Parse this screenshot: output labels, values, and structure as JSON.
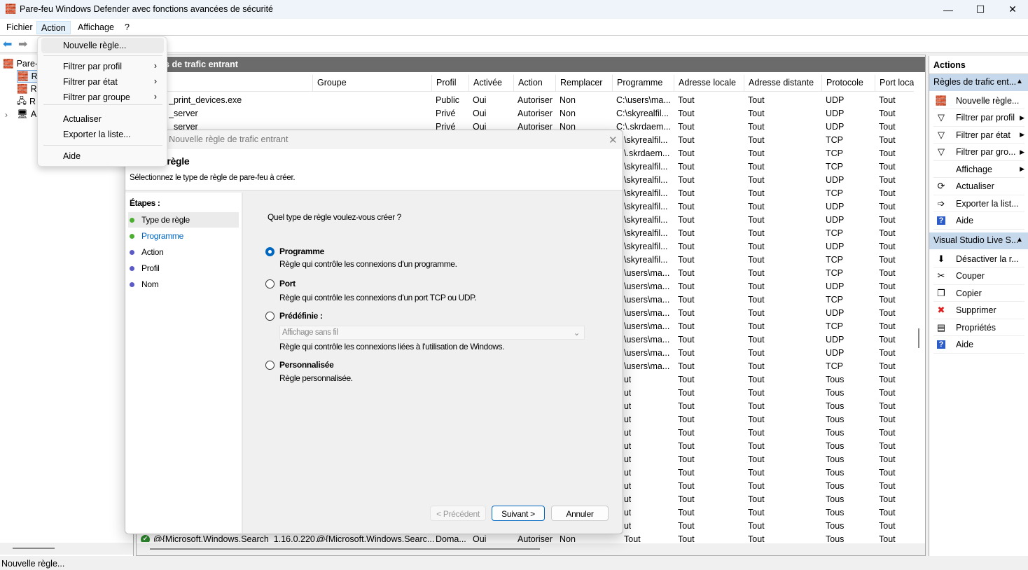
{
  "window": {
    "title": "Pare-feu Windows Defender avec fonctions avancées de sécurité",
    "icon": "firewall-icon"
  },
  "menubar": [
    "Fichier",
    "Action",
    "Affichage",
    "?"
  ],
  "tree": {
    "items": [
      {
        "label": "Pare-"
      },
      {
        "label": "R"
      },
      {
        "label": "R"
      },
      {
        "label": "R"
      },
      {
        "label": "A"
      }
    ]
  },
  "center": {
    "band": "Règles de trafic entrant",
    "columns": [
      "",
      "Groupe",
      "Profil",
      "Activée",
      "Action",
      "Remplacer",
      "Programme",
      "Adresse locale",
      "Adresse distante",
      "Protocole",
      "Port loca"
    ],
    "rows": [
      [
        "_print_devices.exe",
        "",
        "Public",
        "Oui",
        "Autoriser",
        "Non",
        "C:\\users\\ma...",
        "Tout",
        "Tout",
        "UDP",
        "Tout"
      ],
      [
        "_server",
        "",
        "Privé",
        "Oui",
        "Autoriser",
        "Non",
        "C:\\skyrealfil...",
        "Tout",
        "Tout",
        "UDP",
        "Tout"
      ],
      [
        "_server",
        "",
        "Privé",
        "Oui",
        "Autoriser",
        "Non",
        "C:\\.skrdaem...",
        "Tout",
        "Tout",
        "UDP",
        "Tout"
      ],
      [
        "",
        "",
        "",
        "",
        "",
        "",
        "\\skyrealfil...",
        "Tout",
        "Tout",
        "TCP",
        "Tout"
      ],
      [
        "",
        "",
        "",
        "",
        "",
        "",
        "\\.skrdaem...",
        "Tout",
        "Tout",
        "TCP",
        "Tout"
      ],
      [
        "",
        "",
        "",
        "",
        "",
        "",
        "\\skyrealfil...",
        "Tout",
        "Tout",
        "TCP",
        "Tout"
      ],
      [
        "",
        "",
        "",
        "",
        "",
        "",
        "\\skyrealfil...",
        "Tout",
        "Tout",
        "UDP",
        "Tout"
      ],
      [
        "",
        "",
        "",
        "",
        "",
        "",
        "\\skyrealfil...",
        "Tout",
        "Tout",
        "TCP",
        "Tout"
      ],
      [
        "",
        "",
        "",
        "",
        "",
        "",
        "\\skyrealfil...",
        "Tout",
        "Tout",
        "UDP",
        "Tout"
      ],
      [
        "",
        "",
        "",
        "",
        "",
        "",
        "\\skyrealfil...",
        "Tout",
        "Tout",
        "UDP",
        "Tout"
      ],
      [
        "",
        "",
        "",
        "",
        "",
        "",
        "\\skyrealfil...",
        "Tout",
        "Tout",
        "TCP",
        "Tout"
      ],
      [
        "",
        "",
        "",
        "",
        "",
        "",
        "\\skyrealfil...",
        "Tout",
        "Tout",
        "UDP",
        "Tout"
      ],
      [
        "",
        "",
        "",
        "",
        "",
        "",
        "\\skyrealfil...",
        "Tout",
        "Tout",
        "TCP",
        "Tout"
      ],
      [
        "",
        "",
        "",
        "",
        "",
        "",
        "\\users\\ma...",
        "Tout",
        "Tout",
        "TCP",
        "Tout"
      ],
      [
        "",
        "",
        "",
        "",
        "",
        "",
        "\\users\\ma...",
        "Tout",
        "Tout",
        "UDP",
        "Tout"
      ],
      [
        "",
        "",
        "",
        "",
        "",
        "",
        "\\users\\ma...",
        "Tout",
        "Tout",
        "TCP",
        "Tout"
      ],
      [
        "",
        "",
        "",
        "",
        "",
        "",
        "\\users\\ma...",
        "Tout",
        "Tout",
        "UDP",
        "Tout"
      ],
      [
        "",
        "",
        "",
        "",
        "",
        "",
        "\\users\\ma...",
        "Tout",
        "Tout",
        "TCP",
        "Tout"
      ],
      [
        "",
        "",
        "",
        "",
        "",
        "",
        "\\users\\ma...",
        "Tout",
        "Tout",
        "UDP",
        "Tout"
      ],
      [
        "",
        "",
        "",
        "",
        "",
        "",
        "\\users\\ma...",
        "Tout",
        "Tout",
        "UDP",
        "Tout"
      ],
      [
        "",
        "",
        "",
        "",
        "",
        "",
        "\\users\\ma...",
        "Tout",
        "Tout",
        "TCP",
        "Tout"
      ],
      [
        "",
        "",
        "",
        "",
        "",
        "",
        "ut",
        "Tout",
        "Tout",
        "Tous",
        "Tout"
      ],
      [
        "",
        "",
        "",
        "",
        "",
        "",
        "ut",
        "Tout",
        "Tout",
        "Tous",
        "Tout"
      ],
      [
        "",
        "",
        "",
        "",
        "",
        "",
        "ut",
        "Tout",
        "Tout",
        "Tous",
        "Tout"
      ],
      [
        "",
        "",
        "",
        "",
        "",
        "",
        "ut",
        "Tout",
        "Tout",
        "Tous",
        "Tout"
      ],
      [
        "",
        "",
        "",
        "",
        "",
        "",
        "ut",
        "Tout",
        "Tout",
        "Tous",
        "Tout"
      ],
      [
        "",
        "",
        "",
        "",
        "",
        "",
        "ut",
        "Tout",
        "Tout",
        "Tous",
        "Tout"
      ],
      [
        "",
        "",
        "",
        "",
        "",
        "",
        "ut",
        "Tout",
        "Tout",
        "Tous",
        "Tout"
      ],
      [
        "",
        "",
        "",
        "",
        "",
        "",
        "ut",
        "Tout",
        "Tout",
        "Tous",
        "Tout"
      ],
      [
        "",
        "",
        "",
        "",
        "",
        "",
        "ut",
        "Tout",
        "Tout",
        "Tous",
        "Tout"
      ],
      [
        "",
        "",
        "",
        "",
        "",
        "",
        "ut",
        "Tout",
        "Tout",
        "Tous",
        "Tout"
      ],
      [
        "",
        "",
        "",
        "",
        "",
        "",
        "ut",
        "Tout",
        "Tout",
        "Tous",
        "Tout"
      ],
      [
        "",
        "",
        "",
        "",
        "",
        "",
        "ut",
        "Tout",
        "Tout",
        "Tous",
        "Tout"
      ],
      [
        "@{Microsoft.Windows.Search_1.16.0.220...",
        "@{Microsoft.Windows.Searc...",
        "Doma...",
        "Oui",
        "Autoriser",
        "Non",
        "Tout",
        "Tout",
        "Tout",
        "Tous",
        "Tout"
      ]
    ]
  },
  "actions": {
    "title": "Actions",
    "sections": [
      {
        "header": "Règles de trafic ent...",
        "items": [
          {
            "label": "Nouvelle règle...",
            "icon": "new-rule-icon",
            "glyph": "🧱"
          },
          {
            "label": "Filtrer par profil",
            "icon": "filter-icon",
            "glyph": "▽",
            "sub": true
          },
          {
            "label": "Filtrer par état",
            "icon": "filter-icon",
            "glyph": "▽",
            "sub": true
          },
          {
            "label": "Filtrer par gro...",
            "icon": "filter-icon",
            "glyph": "▽",
            "sub": true
          },
          {
            "label": "Affichage",
            "icon": "",
            "glyph": "",
            "sub": true
          },
          {
            "label": "Actualiser",
            "icon": "refresh-icon",
            "glyph": "⟳"
          },
          {
            "label": "Exporter la list...",
            "icon": "export-icon",
            "glyph": "➩"
          },
          {
            "label": "Aide",
            "icon": "help-icon",
            "glyph": "?"
          }
        ]
      },
      {
        "header": "Visual Studio Live S...",
        "items": [
          {
            "label": "Désactiver la r...",
            "icon": "disable-icon",
            "glyph": "⬇"
          },
          {
            "label": "Couper",
            "icon": "cut-icon",
            "glyph": "✂"
          },
          {
            "label": "Copier",
            "icon": "copy-icon",
            "glyph": "❐"
          },
          {
            "label": "Supprimer",
            "icon": "delete-icon",
            "glyph": "✖"
          },
          {
            "label": "Propriétés",
            "icon": "properties-icon",
            "glyph": "▤"
          },
          {
            "label": "Aide",
            "icon": "help-icon",
            "glyph": "?"
          }
        ]
      }
    ]
  },
  "menu": {
    "items": [
      "Nouvelle règle...",
      "Filtrer par profil",
      "Filtrer par état",
      "Filtrer par groupe",
      "Actualiser",
      "Exporter la liste...",
      "Aide"
    ]
  },
  "dialog": {
    "title": "Assistant Nouvelle règle de trafic entrant",
    "heading": "Type de règle",
    "subtitle": "Sélectionnez le type de règle de pare-feu à créer.",
    "steps_label": "Étapes :",
    "steps": [
      {
        "label": "Type de règle",
        "color": "#4caf30"
      },
      {
        "label": "Programme",
        "color": "#4caf30"
      },
      {
        "label": "Action",
        "color": "#5b5bc8"
      },
      {
        "label": "Profil",
        "color": "#5b5bc8"
      },
      {
        "label": "Nom",
        "color": "#5b5bc8"
      }
    ],
    "question": "Quel type de règle voulez-vous créer ?",
    "options": [
      {
        "label": "Programme",
        "desc": "Règle qui contrôle les connexions d'un programme.",
        "selected": true
      },
      {
        "label": "Port",
        "desc": "Règle qui contrôle les connexions d'un port TCP ou UDP.",
        "selected": false
      },
      {
        "label": "Prédéfinie :",
        "desc": "Règle qui contrôle les connexions liées à l'utilisation de Windows.",
        "selected": false
      },
      {
        "label": "Personnalisée",
        "desc": "Règle personnalisée.",
        "selected": false
      }
    ],
    "predefined_value": "Affichage sans fil",
    "buttons": {
      "prev": "< Précédent",
      "next": "Suivant >",
      "cancel": "Annuler"
    }
  },
  "status": "Nouvelle règle..."
}
